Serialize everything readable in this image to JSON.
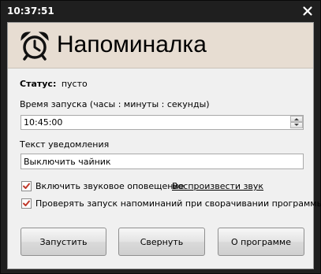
{
  "window": {
    "title": "10:37:51"
  },
  "header": {
    "app_title": "Напоминалка",
    "icon": "alarm-clock-icon"
  },
  "status": {
    "label": "Статус:",
    "value": "пусто"
  },
  "time_field": {
    "label": "Время запуска  (часы : минуты : секунды)",
    "value": "10:45:00"
  },
  "text_field": {
    "label": "Текст уведомления",
    "value": "Выключить чайник"
  },
  "options": {
    "sound_label": "Включить звуковое оповещение",
    "sound_checked": true,
    "play_sound_link": "Воспроизвести звук",
    "check_on_minimize_label": "Проверять запуск напоминаний при сворачивании программы",
    "check_on_minimize_checked": true
  },
  "buttons": {
    "run": "Запустить",
    "minimize": "Свернуть",
    "about": "О программе"
  },
  "colors": {
    "titlebar": "#1f1f1f",
    "header_bg": "#e7ddd2",
    "checkmark": "#c0392b"
  }
}
